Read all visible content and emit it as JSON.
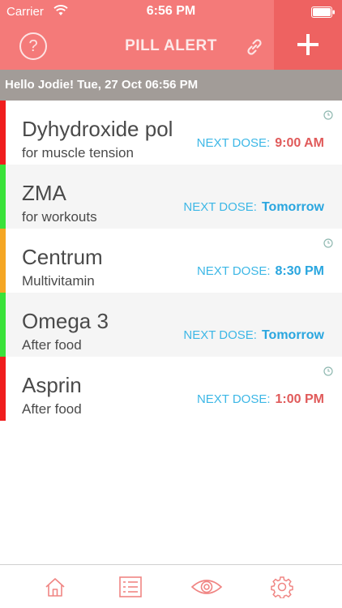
{
  "status_bar": {
    "carrier": "Carrier",
    "time": "6:56 PM"
  },
  "header": {
    "title": "PILL ALERT",
    "help_symbol": "?",
    "accent": "#f47a79"
  },
  "greeting": "Hello Jodie! Tue, 27 Oct 06:56 PM",
  "medications": [
    {
      "name": "Dyhydroxide pol",
      "note": "for muscle tension",
      "dose_label": "NEXT DOSE:",
      "dose_value": "9:00 AM",
      "value_color": "red",
      "indicator_color": "#f01d1d",
      "reminder": true
    },
    {
      "name": "ZMA",
      "note": "for workouts",
      "dose_label": "NEXT DOSE:",
      "dose_value": "Tomorrow",
      "value_color": "blue",
      "indicator_color": "#3ae23a",
      "reminder": false
    },
    {
      "name": "Centrum",
      "note": "Multivitamin",
      "dose_label": "NEXT DOSE:",
      "dose_value": "8:30 PM",
      "value_color": "blue",
      "indicator_color": "#f5a623",
      "reminder": true
    },
    {
      "name": "Omega 3",
      "note": "After food",
      "dose_label": "NEXT DOSE:",
      "dose_value": "Tomorrow",
      "value_color": "blue",
      "indicator_color": "#3ae23a",
      "reminder": false
    },
    {
      "name": "Asprin",
      "note": "After food",
      "dose_label": "NEXT DOSE:",
      "dose_value": "1:00 PM",
      "value_color": "red",
      "indicator_color": "#f01d1d",
      "reminder": true
    }
  ],
  "tabs": [
    {
      "icon": "home-icon",
      "active": true
    },
    {
      "icon": "list-icon",
      "active": false
    },
    {
      "icon": "eye-icon",
      "active": false
    },
    {
      "icon": "settings-gear-icon",
      "active": false
    }
  ]
}
